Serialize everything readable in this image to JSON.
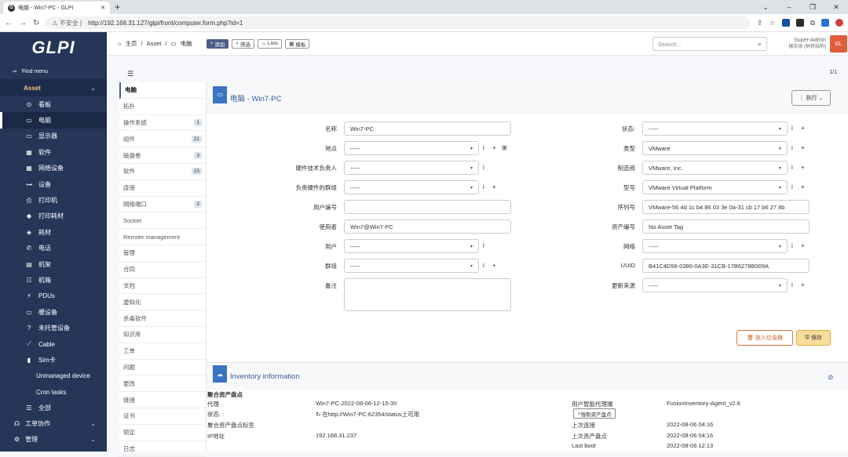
{
  "browser": {
    "tab_title": "电脑 - Win7-PC - GLPI",
    "fav": "G",
    "warning": "不安全",
    "url": "http://192.168.31.127/glpi/front/computer.form.php?id=1"
  },
  "sidebar": {
    "logo": "GLPI",
    "find_menu": "Find menu",
    "section": "Asset",
    "items": [
      {
        "label": "看板",
        "icon": "⊙"
      },
      {
        "label": "电脑",
        "icon": "▭"
      },
      {
        "label": "显示器",
        "icon": "▭"
      },
      {
        "label": "软件",
        "icon": "▦"
      },
      {
        "label": "网络设备",
        "icon": "▦"
      },
      {
        "label": "设备",
        "icon": "⊶"
      },
      {
        "label": "打印机",
        "icon": "⎙"
      },
      {
        "label": "打印耗材",
        "icon": "◆"
      },
      {
        "label": "耗材",
        "icon": "◈"
      },
      {
        "label": "电话",
        "icon": "✆"
      },
      {
        "label": "机架",
        "icon": "▤"
      },
      {
        "label": "机箱",
        "icon": "☷"
      },
      {
        "label": "PDUs",
        "icon": "⚡"
      },
      {
        "label": "暖设备",
        "icon": "▭"
      },
      {
        "label": "未托管设备",
        "icon": "?"
      },
      {
        "label": "Cable",
        "icon": "⟋"
      },
      {
        "label": "Sim卡",
        "icon": "▮"
      }
    ],
    "subitems": [
      "Unmanaged device",
      "Cron tasks"
    ],
    "all": "全部",
    "bottom": [
      "工单协作",
      "管理"
    ]
  },
  "topbar": {
    "home": "主页",
    "asset": "Asset",
    "page": "电脑",
    "add": "添加",
    "filter": "筛选",
    "lists": "Lists",
    "template": "模板",
    "search_placeholder": "Search...",
    "user": "Super-Admin",
    "entity": "根实体 (树状结构)",
    "avatar": "GL"
  },
  "pager": "1/1",
  "vtabs": [
    {
      "label": "电脑",
      "count": ""
    },
    {
      "label": "拓扑",
      "count": ""
    },
    {
      "label": "操作系统",
      "count": "1"
    },
    {
      "label": "组件",
      "count": "21"
    },
    {
      "label": "磁盘卷",
      "count": "3"
    },
    {
      "label": "软件",
      "count": "15"
    },
    {
      "label": "连接",
      "count": ""
    },
    {
      "label": "网络端口",
      "count": "2"
    },
    {
      "label": "Socket",
      "count": ""
    },
    {
      "label": "Remote management",
      "count": ""
    },
    {
      "label": "管理",
      "count": ""
    },
    {
      "label": "合同",
      "count": ""
    },
    {
      "label": "文档",
      "count": ""
    },
    {
      "label": "虚拟化",
      "count": ""
    },
    {
      "label": "杀毒软件",
      "count": ""
    },
    {
      "label": "知识库",
      "count": ""
    },
    {
      "label": "工单",
      "count": ""
    },
    {
      "label": "问题",
      "count": ""
    },
    {
      "label": "更改",
      "count": ""
    },
    {
      "label": "链接",
      "count": ""
    },
    {
      "label": "证书",
      "count": ""
    },
    {
      "label": "锁定",
      "count": ""
    },
    {
      "label": "日志",
      "count": ""
    }
  ],
  "form": {
    "title": "电脑 - Win7-PC",
    "exec": "执行",
    "left": [
      {
        "label": "名称",
        "value": "Win7-PC"
      },
      {
        "label": "地点",
        "value": "-----"
      },
      {
        "label": "硬件技术负责人",
        "value": "-----"
      },
      {
        "label": "负责硬件的群组",
        "value": "-----"
      },
      {
        "label": "用户编号",
        "value": ""
      },
      {
        "label": "使用者",
        "value": "Win7@Win7-PC"
      },
      {
        "label": "用户",
        "value": "-----"
      },
      {
        "label": "群组",
        "value": "-----"
      },
      {
        "label": "备注",
        "value": ""
      }
    ],
    "right": [
      {
        "label": "状态:",
        "value": "-----"
      },
      {
        "label": "类型",
        "value": "VMware"
      },
      {
        "label": "制造商",
        "value": "VMware, Inc."
      },
      {
        "label": "型号",
        "value": "VMware Virtual Platform"
      },
      {
        "label": "序列号",
        "value": "VMware-56 4d 1c b4 86 03 3e 0a-31 cb 17 b6 27 8b"
      },
      {
        "label": "资产编号",
        "value": "No Asset Tag"
      },
      {
        "label": "网络",
        "value": "-----"
      },
      {
        "label": "UUID",
        "value": "B41C4D56-0386-0A3E-31CB-17B6278B009A"
      },
      {
        "label": "更新来源",
        "value": "-----"
      }
    ],
    "trash": "放入垃圾桶",
    "save": "保存"
  },
  "inventory": {
    "title": "Inventory information",
    "section": "聚合资产盘点",
    "rows": [
      {
        "label": "代理",
        "value": "Win7-PC-2022-08-06-12-15-30",
        "label2": "用户智能代理端",
        "value2": "FusionInventory-Agent_v2.6"
      },
      {
        "label": "状态: :",
        "value": "在http://Win7-PC:62354/status上可用",
        "label2": "",
        "value2": ""
      },
      {
        "label": "聚合资产盘点标签",
        "value": "",
        "label2": "上次连接",
        "value2": "2022-08-06 04:16"
      },
      {
        "label": "IP地址",
        "value": "192.168.31.237",
        "label2": "上次资产盘点",
        "value2": "2022-08-06 04:16"
      },
      {
        "label": "",
        "value": "",
        "label2": "Last boot",
        "value2": "2022-08-06 12:13"
      }
    ],
    "force": "强制资产盘点"
  }
}
